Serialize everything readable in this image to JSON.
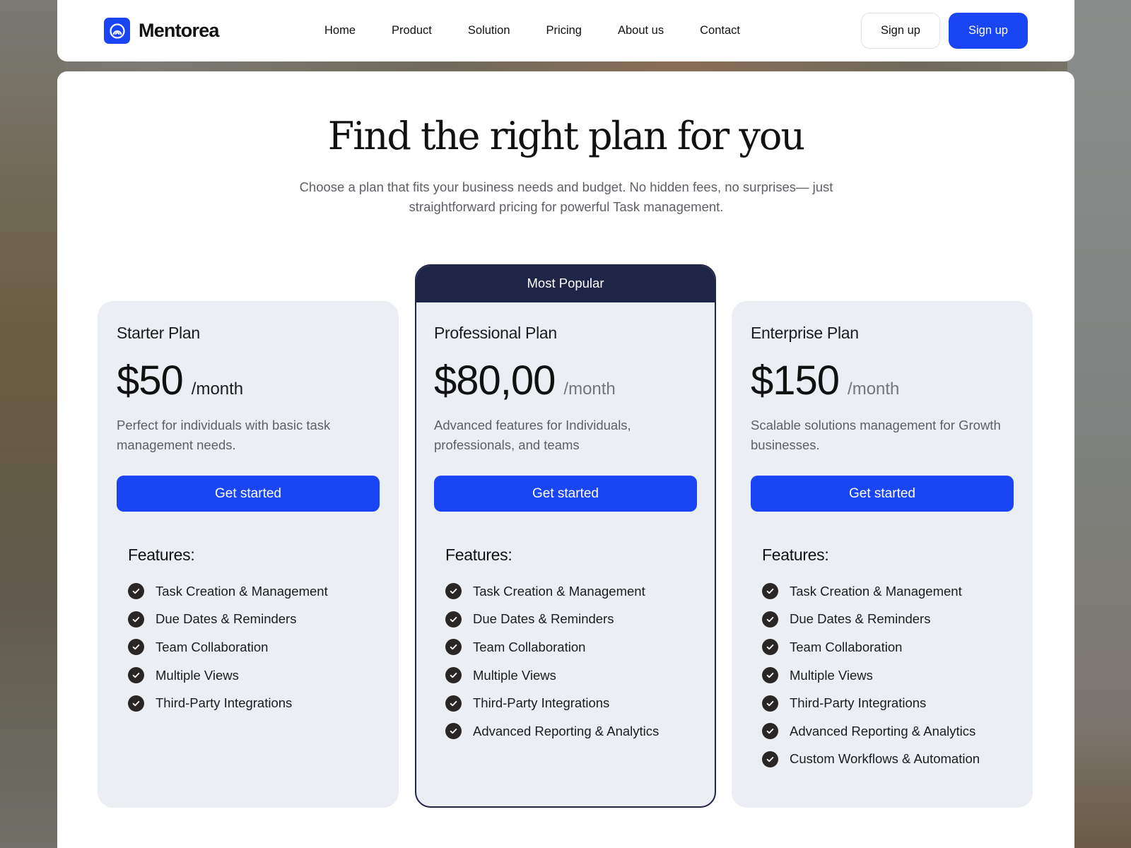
{
  "brand": {
    "name": "Mentorea",
    "logo_icon": "arc-logo-icon",
    "accent": "#1a45f5"
  },
  "nav": {
    "links": [
      "Home",
      "Product",
      "Solution",
      "Pricing",
      "About us",
      "Contact"
    ],
    "signup_outline_label": "Sign up",
    "signup_primary_label": "Sign up"
  },
  "hero": {
    "title": "Find the right plan for you",
    "subtitle": "Choose a plan that fits your business needs and budget. No hidden fees, no surprises— just straightforward pricing for powerful Task management."
  },
  "plans": [
    {
      "name": "Starter Plan",
      "price": "$50",
      "period": "/month",
      "description": "Perfect for individuals with basic task management needs.",
      "cta": "Get started",
      "features_title": "Features:",
      "features": [
        "Task Creation & Management",
        "Due Dates & Reminders",
        "Team Collaboration",
        "Multiple Views",
        "Third-Party Integrations"
      ]
    },
    {
      "badge": "Most Popular",
      "name": "Professional Plan",
      "price": "$80,00",
      "period": "/month",
      "description": "Advanced features for Individuals, professionals, and teams",
      "cta": "Get started",
      "features_title": "Features:",
      "features": [
        "Task Creation & Management",
        "Due Dates & Reminders",
        "Team Collaboration",
        "Multiple Views",
        "Third-Party Integrations",
        "Advanced Reporting & Analytics"
      ]
    },
    {
      "name": "Enterprise Plan",
      "price": "$150",
      "period": "/month",
      "description": "Scalable solutions management for Growth businesses.",
      "cta": "Get started",
      "features_title": "Features:",
      "features": [
        "Task Creation & Management",
        "Due Dates & Reminders",
        "Team Collaboration",
        "Multiple Views",
        "Third-Party Integrations",
        "Advanced Reporting & Analytics",
        "Custom Workflows & Automation"
      ]
    }
  ],
  "colors": {
    "primary": "#1a45f5",
    "popular_navy": "#1f2547",
    "card_bg": "#ebeef2",
    "check_bg": "#2a2625"
  }
}
